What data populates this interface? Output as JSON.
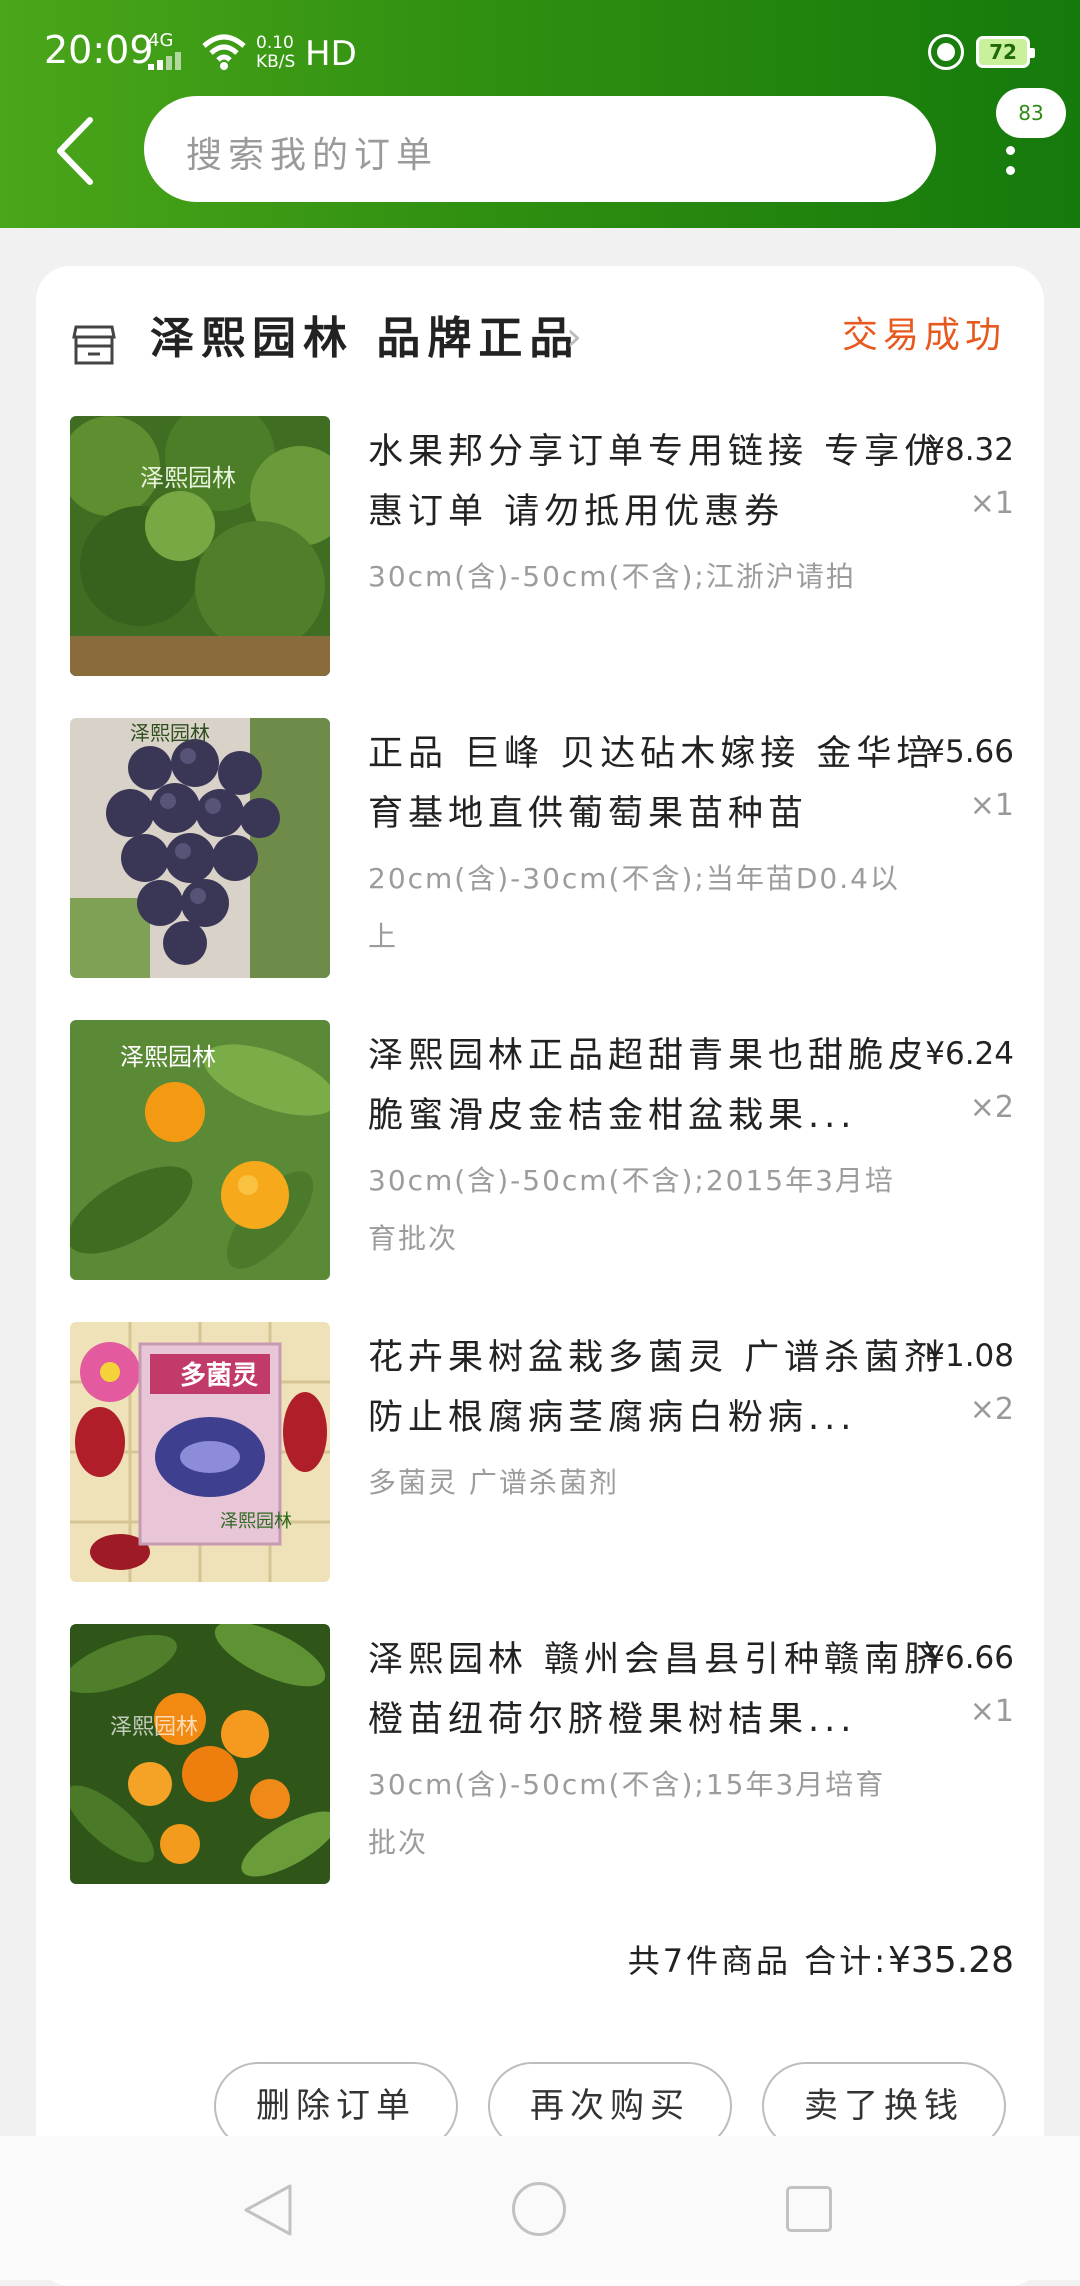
{
  "status_bar": {
    "time": "20:09",
    "network": "4G",
    "speed_value": "0.10",
    "speed_unit": "KB/S",
    "hd": "HD",
    "battery": "72"
  },
  "header": {
    "search_placeholder": "搜索我的订单",
    "more_badge": "83"
  },
  "order": {
    "shop_name": "泽熙园林 品牌正品",
    "status": "交易成功",
    "items": [
      {
        "title": "水果邦分享订单专用链接 专享优惠订单 请勿抵用优惠券",
        "spec": "30cm(含)-50cm(不含);江浙沪请拍",
        "price": "¥8.32",
        "qty": "×1"
      },
      {
        "title": "正品 巨峰 贝达砧木嫁接 金华培育基地直供葡萄果苗种苗",
        "spec": "20cm(含)-30cm(不含);当年苗D0.4以上",
        "price": "¥5.66",
        "qty": "×1"
      },
      {
        "title": "泽熙园林正品超甜青果也甜脆皮脆蜜滑皮金桔金柑盆栽果...",
        "spec": "30cm(含)-50cm(不含);2015年3月培育批次",
        "price": "¥6.24",
        "qty": "×2"
      },
      {
        "title": "花卉果树盆栽多菌灵 广谱杀菌剂防止根腐病茎腐病白粉病...",
        "spec": "多菌灵 广谱杀菌剂",
        "price": "¥1.08",
        "qty": "×2"
      },
      {
        "title": "泽熙园林 赣州会昌县引种赣南脐橙苗纽荷尔脐橙果树桔果...",
        "spec": "30cm(含)-50cm(不含);15年3月培育批次",
        "price": "¥6.66",
        "qty": "×1"
      }
    ],
    "summary_count": "共7件商品",
    "summary_label": "合计:",
    "summary_total": "¥35.28"
  },
  "buttons": {
    "delete": "删除订单",
    "rebuy": "再次购买",
    "sell": "卖了换钱"
  },
  "thumb_labels": {
    "brand": "泽熙园林",
    "product4": "多菌灵"
  }
}
